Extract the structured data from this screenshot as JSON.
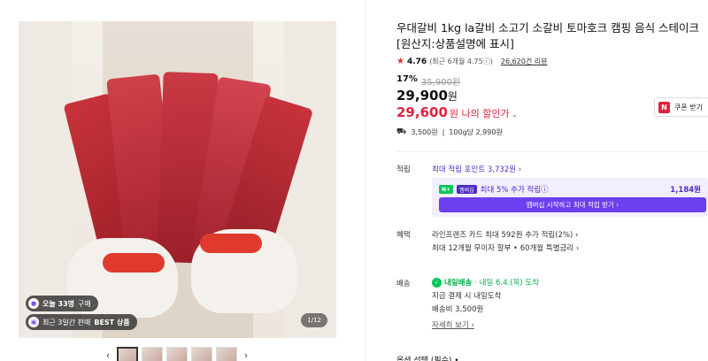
{
  "gallery": {
    "badges": [
      {
        "icon": "purple-dot-icon",
        "text_bold": "오늘 33명",
        "text": "구매"
      },
      {
        "icon": "gift-icon",
        "text_prefix": "최근 3일간 판매",
        "text_bold": "BEST 상품"
      }
    ],
    "counter": "1/12",
    "prev": "‹",
    "next": "›",
    "thumbnail_count": 5
  },
  "product": {
    "title": "우대갈비 1kg la갈비 소고기 소갈비 토마호크 캠핑 음식 스테이크 [원산지:상품설명에 표시]",
    "rating": {
      "score": "4.76",
      "recent": "(최근 6개월 4.75ⓘ)",
      "reviews": "26,620건 리뷰"
    },
    "discount_rate": "17%",
    "original_price": "35,900원",
    "price": "29,900",
    "price_unit": "원",
    "my_price": "29,600",
    "my_price_label": "원 나의 할인가",
    "coupon": {
      "badge": "N",
      "label": "쿠폰 받기"
    },
    "shipping_fee": "3,500원",
    "unit_price": "100g당 2,990원"
  },
  "points": {
    "label": "적립",
    "max": "최대 적립 포인트 3,732원 ›",
    "membership_badge": "N+",
    "membership_badge2": "멤버십",
    "membership_text": "최대 5% 추가 적립ⓘ",
    "membership_amount": "1,184원",
    "membership_button": "멤버십 시작하고 최대 적립 받기 ›"
  },
  "benefits": {
    "label": "혜택",
    "line1": "라인프렌즈 카드 최대 592원 추가 적립(2%) ›",
    "line2": "최대 12개월 무이자 할부 • 60개월 특별금리 ›"
  },
  "delivery": {
    "label": "배송",
    "brand": "내일배송",
    "date": "· 내일 6.4.(목) 도착",
    "line2": "지금 결제 시 내일도착",
    "fee": "배송비 3,500원",
    "details": "자세히 보기 ›"
  },
  "options": {
    "label": "옵션 선택 (필수) •"
  },
  "colors": {
    "accent_red": "#e0233d",
    "accent_purple": "#4f2cc9",
    "naver_green": "#03c75a"
  }
}
